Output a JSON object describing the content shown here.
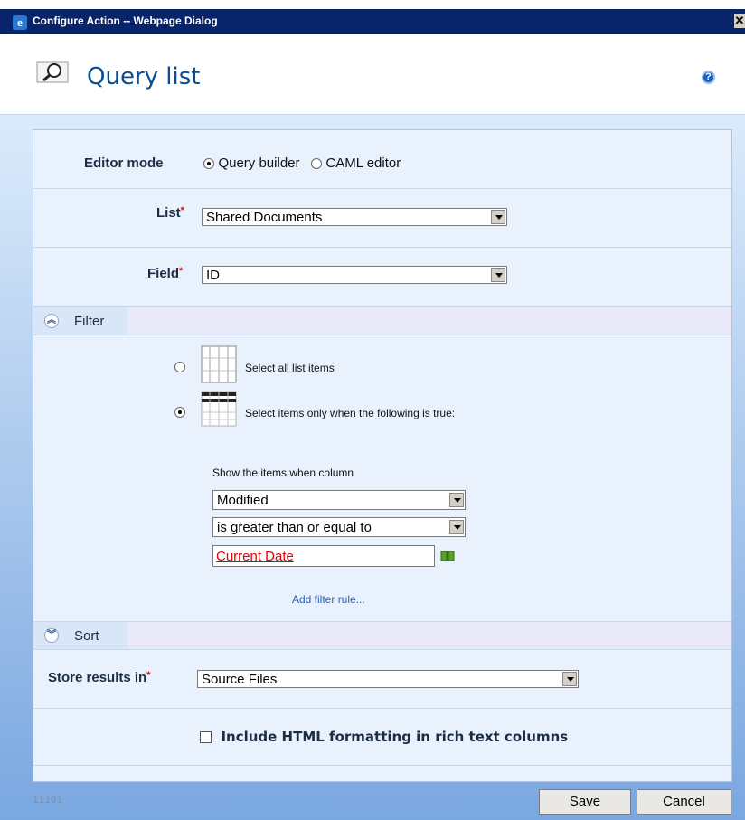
{
  "window": {
    "title": "Configure Action -- Webpage Dialog"
  },
  "header": {
    "title": "Query list",
    "help_icon": "help-icon"
  },
  "editor_mode": {
    "label": "Editor mode",
    "options": [
      {
        "label": "Query builder",
        "checked": true
      },
      {
        "label": "CAML editor",
        "checked": false
      }
    ]
  },
  "list": {
    "label": "List",
    "required": "*",
    "value": "Shared Documents"
  },
  "field": {
    "label": "Field",
    "required": "*",
    "value": "ID"
  },
  "filter": {
    "section_label": "Filter",
    "expanded": true,
    "select_all_label": "Select all list items",
    "select_conditional_label": "Select items only when the following is true:",
    "conditional_selected": true,
    "show_items_label": "Show the items when column",
    "column_value": "Modified",
    "operator_value": "is greater than or equal to",
    "comparison_value": "Current Date",
    "add_rule_label": "Add filter rule..."
  },
  "sort": {
    "section_label": "Sort",
    "expanded": false
  },
  "store_results": {
    "label": "Store results in",
    "required": "*",
    "value": "Source Files"
  },
  "include_html": {
    "label": "Include HTML formatting in rich text columns",
    "checked": false
  },
  "footer": {
    "id_text": "11101",
    "save_label": "Save",
    "cancel_label": "Cancel"
  },
  "colors": {
    "title_bar": "#0a246a",
    "page_title": "#0b4d8e",
    "required": "#d01010",
    "link": "#2c62b0"
  }
}
